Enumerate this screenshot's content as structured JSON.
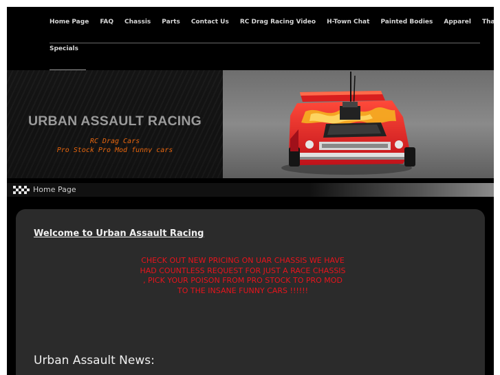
{
  "nav": {
    "items": [
      {
        "label": "Home Page"
      },
      {
        "label": "FAQ"
      },
      {
        "label": "Chassis"
      },
      {
        "label": "Parts"
      },
      {
        "label": "Contact Us"
      },
      {
        "label": "RC Drag Racing Video"
      },
      {
        "label": "H-Town Chat"
      },
      {
        "label": "Painted Bodies"
      },
      {
        "label": "Apparel"
      },
      {
        "label": "Thank You"
      },
      {
        "label": "Specials"
      }
    ]
  },
  "header": {
    "title": "URBAN ASSAULT RACING",
    "tagline_line1": "RC Drag Cars",
    "tagline_line2": "Pro Stock Pro Mod funny cars"
  },
  "breadcrumb": {
    "current": "Home Page"
  },
  "content": {
    "welcome": "Welcome to Urban Assault Racing",
    "promo": "CHECK OUT NEW PRICING ON UAR CHASSIS WE HAVE HAD COUNTLESS REQUEST FOR JUST A RACE CHASSIS , PICK YOUR POISON FROM PRO STOCK TO PRO MOD TO THE INSANE FUNNY CARS !!!!!!",
    "news_heading": "Urban Assault News:"
  },
  "colors": {
    "promo_red": "#e8141c",
    "tagline_orange": "#e8660e",
    "background": "#000000"
  }
}
